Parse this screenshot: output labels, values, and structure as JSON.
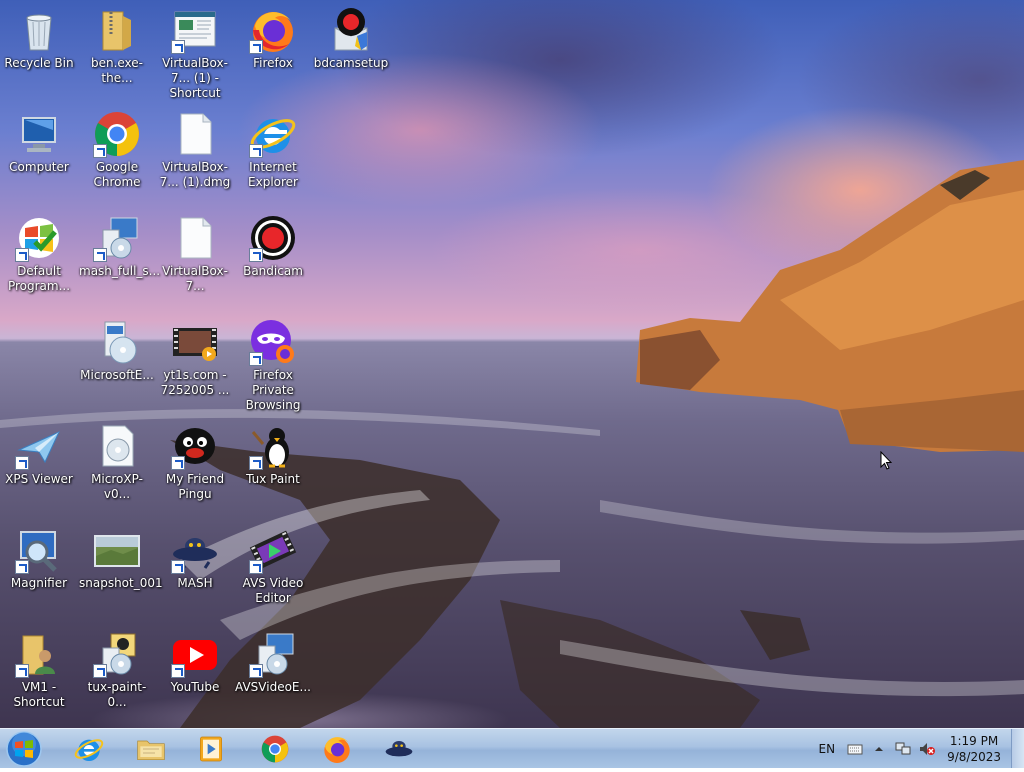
{
  "desktop": {
    "icons": [
      {
        "label": "Recycle Bin",
        "icon": "recycle-bin-icon"
      },
      {
        "label": "ben.exe-the...",
        "icon": "zip-folder-icon"
      },
      {
        "label": "VirtualBox-7... (1) - Shortcut",
        "icon": "virtualbox-shortcut-icon"
      },
      {
        "label": "Firefox",
        "icon": "firefox-icon"
      },
      {
        "label": "bdcamsetup",
        "icon": "bandicam-setup-icon"
      },
      {
        "label": "Computer",
        "icon": "computer-icon"
      },
      {
        "label": "Google Chrome",
        "icon": "chrome-icon"
      },
      {
        "label": "VirtualBox-7... (1).dmg",
        "icon": "file-icon"
      },
      {
        "label": "Internet Explorer",
        "icon": "internet-explorer-icon"
      },
      {
        "label": "Default Program...",
        "icon": "default-programs-icon"
      },
      {
        "label": "mash_full_s...",
        "icon": "installer-icon"
      },
      {
        "label": "VirtualBox-7...",
        "icon": "file-icon"
      },
      {
        "label": "Bandicam",
        "icon": "bandicam-icon"
      },
      {
        "label": "MicrosoftE...",
        "icon": "installer-disc-icon"
      },
      {
        "label": "yt1s.com - 7252005 ...",
        "icon": "video-file-icon"
      },
      {
        "label": "Firefox Private Browsing",
        "icon": "firefox-private-icon"
      },
      {
        "label": "XPS Viewer",
        "icon": "xps-viewer-icon"
      },
      {
        "label": "MicroXP-v0...",
        "icon": "disc-image-icon"
      },
      {
        "label": "My Friend Pingu",
        "icon": "pingu-icon"
      },
      {
        "label": "Tux Paint",
        "icon": "tux-paint-icon"
      },
      {
        "label": "Magnifier",
        "icon": "magnifier-icon"
      },
      {
        "label": "snapshot_001",
        "icon": "image-file-icon"
      },
      {
        "label": "MASH",
        "icon": "mash-icon"
      },
      {
        "label": "AVS Video Editor",
        "icon": "avs-video-editor-icon"
      },
      {
        "label": "VM1 - Shortcut",
        "icon": "user-folder-icon"
      },
      {
        "label": "tux-paint-0...",
        "icon": "installer-icon"
      },
      {
        "label": "YouTube",
        "icon": "youtube-icon"
      },
      {
        "label": "AVSVideoE...",
        "icon": "installer-icon"
      }
    ]
  },
  "taskbar": {
    "pinned": [
      "internet-explorer",
      "file-explorer",
      "media-player",
      "chrome",
      "firefox",
      "mash"
    ],
    "tray": {
      "language": "EN",
      "time": "1:19 PM",
      "date": "9/8/2023"
    }
  },
  "colors": {
    "taskbar": "#a8c2e2",
    "link_blue": "#1c5bc7"
  }
}
